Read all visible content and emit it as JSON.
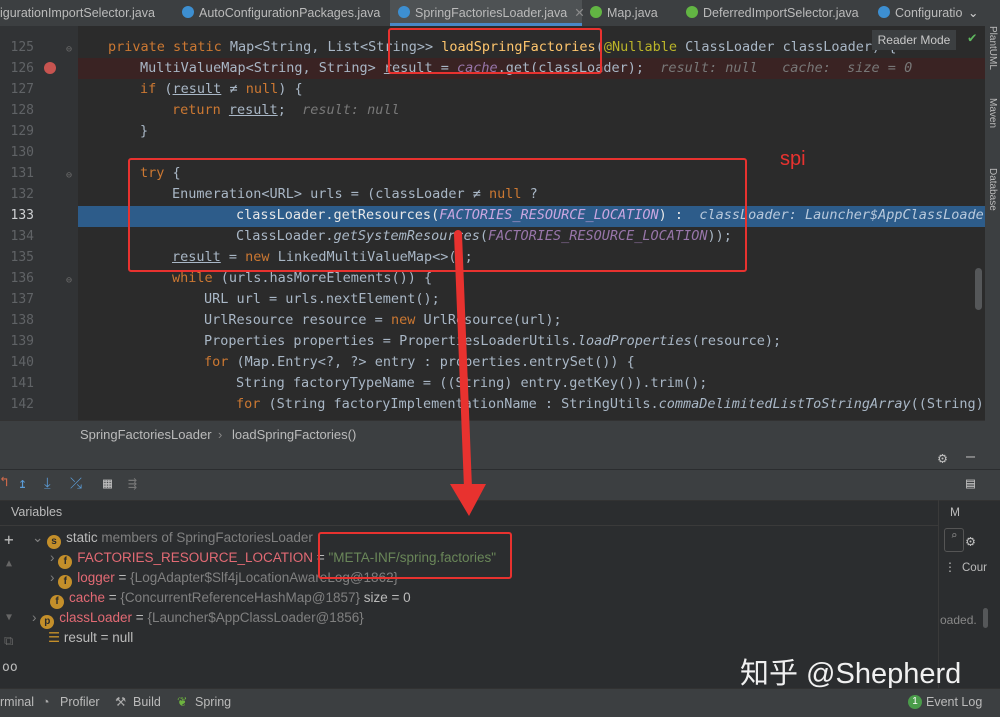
{
  "tabs": [
    {
      "label": "igurationImportSelector.java",
      "icon_color": "#5a9bd4"
    },
    {
      "label": "AutoConfigurationPackages.java",
      "icon_color": "#3d8fd1"
    },
    {
      "label": "SpringFactoriesLoader.java",
      "icon_color": "#3d8fd1",
      "active": true
    },
    {
      "label": "Map.java",
      "icon_color": "#62b543"
    },
    {
      "label": "DeferredImportSelector.java",
      "icon_color": "#62b543"
    },
    {
      "label": "Configuratio",
      "icon_color": "#3d8fd1"
    }
  ],
  "reader_mode": "Reader Mode",
  "right_tools": [
    "PlantUML",
    "Maven",
    "Database"
  ],
  "line_numbers": [
    "125",
    "126",
    "127",
    "128",
    "129",
    "130",
    "131",
    "132",
    "133",
    "134",
    "135",
    "136",
    "137",
    "138",
    "139",
    "140",
    "141",
    "142"
  ],
  "code": {
    "l125": {
      "a": "private static ",
      "b": "Map<String, List<String>> ",
      "fn": "loadSpringFactories",
      "c": "(",
      "an": "@Nullable",
      "d": " ClassLoader classLoader) {"
    },
    "l126": {
      "a": "MultiValueMap<String, String> ",
      "u": "result",
      "b": " = ",
      "cn": "cache",
      "c": ".get(classLoader);",
      "hint": "result: null   cache:  size = 0"
    },
    "l127": {
      "kw": "if",
      "a": " (",
      "u": "result",
      "b": " ≠ ",
      "kw2": "null",
      "c": ") {"
    },
    "l128": {
      "kw": "return ",
      "u": "result",
      "c": ";",
      "hint": "result: null"
    },
    "l129": "}",
    "l131": {
      "kw": "try",
      "c": " {"
    },
    "l132": {
      "a": "Enumeration<URL> urls = (classLoader ≠ ",
      "kw": "null",
      "c": " ?"
    },
    "l133": {
      "a": "classLoader.getResources(",
      "cn": "FACTORIES_RESOURCE_LOCATION",
      "c": ") :",
      "hint": "classLoader: Launcher$AppClassLoader@1856"
    },
    "l134": {
      "a": "ClassLoader.",
      "it": "getSystemResources",
      "b": "(",
      "cn": "FACTORIES_RESOURCE_LOCATION",
      "c": "));"
    },
    "l135": {
      "u": "result",
      "a": " = ",
      "kw": "new",
      "c": " LinkedMultiValueMap<>();"
    },
    "l136": {
      "kw": "while",
      "c": " (urls.hasMoreElements()) {"
    },
    "l137": "URL url = urls.nextElement();",
    "l138": {
      "a": "UrlResource resource = ",
      "kw": "new",
      "c": " UrlResource(url);"
    },
    "l139": {
      "a": "Properties properties = PropertiesLoaderUtils.",
      "it": "loadProperties",
      "c": "(resource);"
    },
    "l140": {
      "kw": "for",
      "c": " (Map.Entry<?, ?> entry : properties.entrySet()) {"
    },
    "l141": "String factoryTypeName = ((String) entry.getKey()).trim();",
    "l142": {
      "kw": "for",
      "a": " (String factoryImplementationName : StringUtils.",
      "it": "commaDelimitedListToStringArray",
      "c": "((String)"
    }
  },
  "annotation_spi": "spi",
  "breadcrumb": [
    "SpringFactoriesLoader",
    "loadSpringFactories()"
  ],
  "variables": {
    "title": "Variables",
    "static_row": {
      "a": "static",
      "b": " members of SpringFactoriesLoader"
    },
    "rows": [
      {
        "name": "FACTORIES_RESOURCE_LOCATION",
        "eq": " = ",
        "value": "\"META-INF/spring.factories\""
      },
      {
        "name": "logger",
        "eq": " = ",
        "value": "{LogAdapter$Slf4jLocationAwareLog@1862}"
      },
      {
        "name": "cache",
        "eq": " = ",
        "value": "{ConcurrentReferenceHashMap@1857}",
        "extra": "  size = 0"
      },
      {
        "name": "classLoader",
        "eq": " = ",
        "value": "{Launcher$AppClassLoader@1856}"
      },
      {
        "name": "result",
        "eq": " = ",
        "value": "null"
      }
    ],
    "side_text": {
      "m": "M",
      "cour": "Cour",
      "loaded": "oaded."
    }
  },
  "status_tabs": [
    "rminal",
    "Profiler",
    "Build",
    "Spring"
  ],
  "event_log": {
    "count": "1",
    "label": "Event Log"
  },
  "watermark": "知乎 @Shepherd",
  "colors": {
    "annotation_red": "#e8322f",
    "execution_line": "#2d5c8a",
    "breakpoint": "#c75450"
  }
}
